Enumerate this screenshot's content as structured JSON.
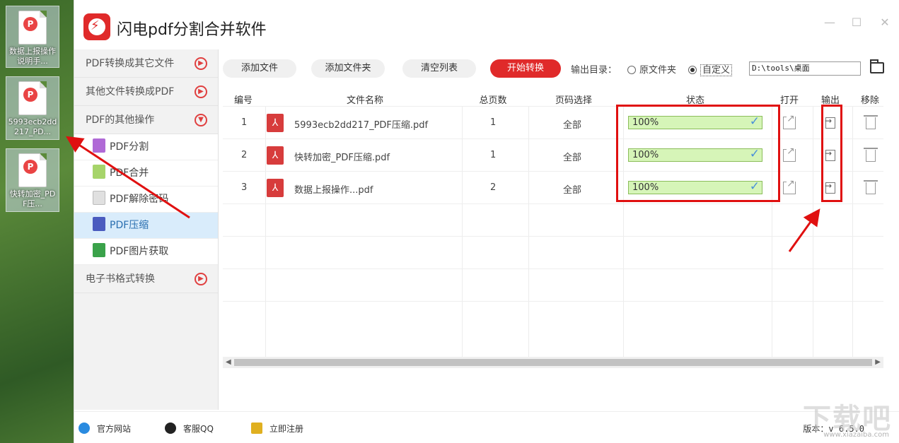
{
  "desktop": {
    "icons": [
      {
        "label": "数据上报操作说明手..."
      },
      {
        "label": "5993ecb2dd217_PD..."
      },
      {
        "label": "快转加密_PDF压..."
      }
    ]
  },
  "app": {
    "title": "闪电pdf分割合并软件",
    "window_controls": {
      "minimize": "—",
      "maximize": "☐",
      "close": "✕"
    }
  },
  "sidebar": {
    "categories": [
      {
        "label": "PDF转换成其它文件",
        "state": "collapsed"
      },
      {
        "label": "其他文件转换成PDF",
        "state": "collapsed"
      },
      {
        "label": "PDF的其他操作",
        "state": "expanded"
      }
    ],
    "subitems": [
      {
        "label": "PDF分割",
        "icon_color": "#b06ad6"
      },
      {
        "label": "PDF合并",
        "icon_color": "#a6d46a"
      },
      {
        "label": "PDF解除密码",
        "icon_color": "#e0e0e0"
      },
      {
        "label": "PDF压缩",
        "icon_color": "#4a5bbf",
        "active": true
      },
      {
        "label": "PDF图片获取",
        "icon_color": "#3aa24a"
      }
    ],
    "bottom_category": {
      "label": "电子书格式转换",
      "state": "collapsed"
    }
  },
  "toolbar": {
    "add_file": "添加文件",
    "add_folder": "添加文件夹",
    "clear_list": "清空列表",
    "start": "开始转换",
    "output_dir_label": "输出目录：",
    "radio_original": "原文件夹",
    "radio_custom": "自定义",
    "path_value": "D:\\tools\\桌面"
  },
  "table": {
    "headers": {
      "num": "编号",
      "name": "文件名称",
      "pages": "总页数",
      "range": "页码选择",
      "status": "状态",
      "open": "打开",
      "output": "输出",
      "remove": "移除"
    },
    "rows": [
      {
        "num": "1",
        "name": "5993ecb2dd217_PDF压缩.pdf",
        "pages": "1",
        "range": "全部",
        "status": "100%",
        "progress": 100
      },
      {
        "num": "2",
        "name": "快转加密_PDF压缩.pdf",
        "pages": "1",
        "range": "全部",
        "status": "100%",
        "progress": 100
      },
      {
        "num": "3",
        "name": "数据上报操作...pdf",
        "pages": "2",
        "range": "全部",
        "status": "100%",
        "progress": 100
      }
    ]
  },
  "footer": {
    "website": "官方网站",
    "support": "客服QQ",
    "register": "立即注册",
    "version_label": "版本：",
    "version_value": "v 6.5.0"
  },
  "watermark": {
    "text": "下载吧",
    "url": "www.xiazaiba.com"
  },
  "colors": {
    "accent_red": "#e02a2a",
    "active_blue": "#d9ecfb",
    "progress_green": "#d6f5b8",
    "highlight_red": "#e01010"
  }
}
